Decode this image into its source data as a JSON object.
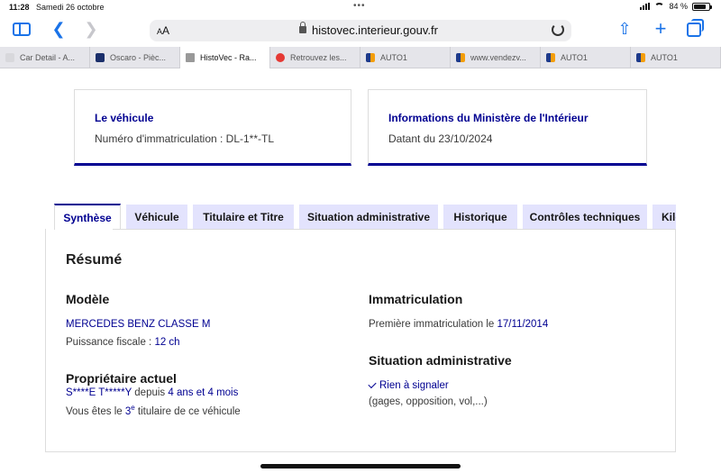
{
  "status": {
    "time": "11:28",
    "date": "Samedi 26 octobre",
    "battery": "84 %",
    "battery_level": 0.84
  },
  "browser": {
    "text_size_label": "AA",
    "url": "histovec.interieur.gouv.fr",
    "tabs": [
      {
        "label": "Car Detail - A...",
        "icon": "w"
      },
      {
        "label": "Oscaro - Pièc...",
        "icon": "o"
      },
      {
        "label": "HistoVec - Ra...",
        "icon": "x",
        "active": true
      },
      {
        "label": "Retrouvez les...",
        "icon": "r"
      },
      {
        "label": "AUTO1",
        "icon": "auto"
      },
      {
        "label": "www.vendezv...",
        "icon": "auto"
      },
      {
        "label": "AUTO1",
        "icon": "auto"
      },
      {
        "label": "AUTO1",
        "icon": "auto"
      }
    ]
  },
  "cards": {
    "vehicle": {
      "title": "Le véhicule",
      "text": "Numéro d'immatriculation : DL-1**-TL"
    },
    "ministry": {
      "title": "Informations du Ministère de l'Intérieur",
      "text": "Datant du 23/10/2024"
    }
  },
  "page_tabs": [
    "Synthèse",
    "Véhicule",
    "Titulaire et Titre",
    "Situation administrative",
    "Historique",
    "Contrôles techniques",
    "Kilo"
  ],
  "resume": {
    "title": "Résumé",
    "modele": {
      "heading": "Modèle",
      "name": "MERCEDES BENZ CLASSE M",
      "puissance_label": "Puissance fiscale : ",
      "puissance_value": "12 ch"
    },
    "proprietaire": {
      "heading": "Propriétaire actuel",
      "name": "S****E T*****Y",
      "depuis_label": " depuis ",
      "depuis_value": "4 ans et 4 mois",
      "rank_prefix": "Vous êtes le ",
      "rank_num": "3",
      "rank_sup": "e",
      "rank_suffix": " titulaire de ce véhicule"
    },
    "immatriculation": {
      "heading": "Immatriculation",
      "label": "Première immatriculation le ",
      "date": "17/11/2014"
    },
    "situation": {
      "heading": "Situation administrative",
      "status": "Rien à signaler",
      "note": "(gages, opposition, vol,...)"
    }
  }
}
